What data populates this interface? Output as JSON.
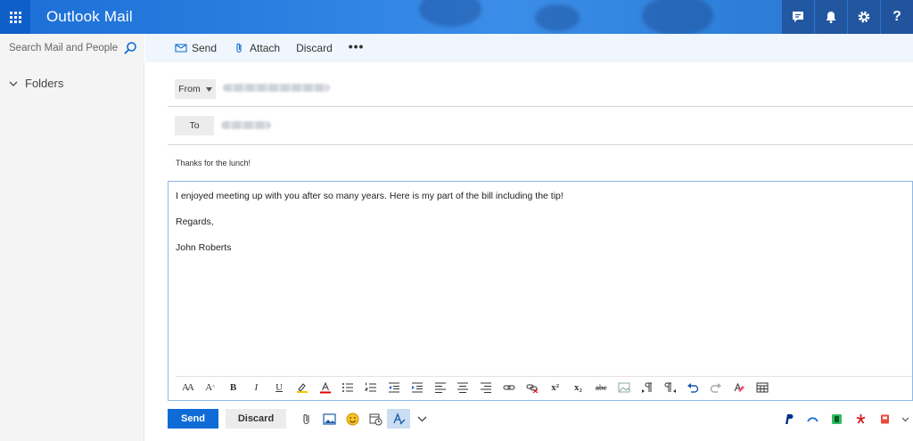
{
  "header": {
    "app_title": "Outlook Mail",
    "icons": [
      "app-launcher-icon",
      "chat-icon",
      "bell-icon",
      "gear-icon",
      "help-icon"
    ],
    "help_label": "?",
    "accent_color": "#1d6ed6"
  },
  "sidebar": {
    "search_placeholder": "Search Mail and People",
    "folders_label": "Folders"
  },
  "command_bar": {
    "send_label": "Send",
    "attach_label": "Attach",
    "discard_label": "Discard",
    "more_label": "•••"
  },
  "compose": {
    "from_label": "From",
    "to_label": "To",
    "subject": "Thanks for the lunch!",
    "body_lines": [
      "I enjoyed meeting up with you after so many years. Here is my part of the bill including the tip!",
      "Regards,",
      "John Roberts"
    ]
  },
  "format_toolbar": {
    "font_size_label": "AA",
    "grow_font_label": "A",
    "bold_label": "B",
    "italic_label": "I",
    "underline_label": "U",
    "superscript_label": "x²",
    "subscript_label": "x₂",
    "strikethrough_label": "abc"
  },
  "actions": {
    "send_label": "Send",
    "discard_label": "Discard",
    "send_color": "#0f6cd6"
  },
  "addins": [
    "paypal-icon",
    "arrow-icon",
    "evernote-icon",
    "yelp-icon",
    "office-addin-icon"
  ]
}
